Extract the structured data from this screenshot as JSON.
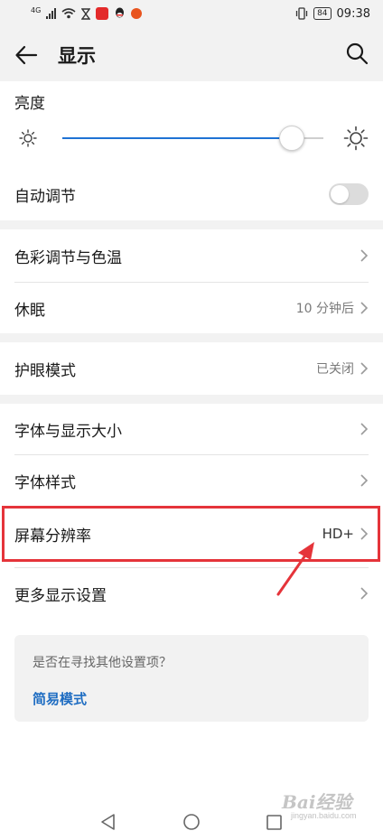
{
  "status_bar": {
    "network": "4G",
    "battery": "84",
    "time": "09:38"
  },
  "header": {
    "title": "显示"
  },
  "brightness": {
    "label": "亮度",
    "level": 0.88
  },
  "auto_adjust": {
    "label": "自动调节",
    "enabled": false
  },
  "settings": {
    "color_temp": {
      "label": "色彩调节与色温"
    },
    "sleep": {
      "label": "休眠",
      "value": "10 分钟后"
    },
    "eye_comfort": {
      "label": "护眼模式",
      "value": "已关闭"
    },
    "font_size": {
      "label": "字体与显示大小"
    },
    "font_style": {
      "label": "字体样式"
    },
    "resolution": {
      "label": "屏幕分辨率",
      "value": "HD+"
    },
    "more_display": {
      "label": "更多显示设置"
    }
  },
  "suggestion": {
    "question": "是否在寻找其他设置项？",
    "link": "简易模式"
  },
  "watermark": {
    "text": "Bai经验",
    "sub": "jingyan.baidu.com"
  },
  "colors": {
    "accent": "#1f73d4",
    "highlight": "#e5343a",
    "link": "#1f6dc2"
  }
}
